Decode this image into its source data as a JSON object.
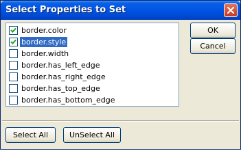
{
  "window": {
    "title": "Select Properties to Set"
  },
  "properties": [
    {
      "label": "border.color",
      "checked": true,
      "selected": false
    },
    {
      "label": "border.style",
      "checked": true,
      "selected": true
    },
    {
      "label": "border.width",
      "checked": false,
      "selected": false
    },
    {
      "label": "border.has_left_edge",
      "checked": false,
      "selected": false
    },
    {
      "label": "border.has_right_edge",
      "checked": false,
      "selected": false
    },
    {
      "label": "border.has_top_edge",
      "checked": false,
      "selected": false
    },
    {
      "label": "border.has_bottom_edge",
      "checked": false,
      "selected": false
    }
  ],
  "buttons": {
    "ok": "OK",
    "cancel": "Cancel",
    "select_all": "Select All",
    "unselect_all": "UnSelect All"
  },
  "colors": {
    "selection": "#316ac5",
    "titlebar": "#0055e5",
    "close": "#c4391f"
  },
  "icons": {
    "close": "close-icon",
    "check": "checkmark-icon"
  }
}
